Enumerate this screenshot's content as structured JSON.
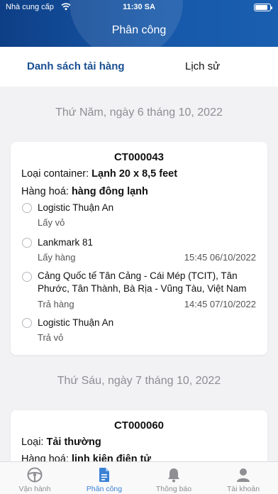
{
  "status": {
    "carrier": "Nhà cung cấp",
    "time": "11:30 SA",
    "battery_level": 0.85
  },
  "header": {
    "title": "Phân công"
  },
  "tabs": [
    {
      "label": "Danh sách tải hàng",
      "active": true
    },
    {
      "label": "Lịch sử",
      "active": false
    }
  ],
  "sections": [
    {
      "date": "Thứ Năm, ngày 6 tháng 10, 2022",
      "card": {
        "code": "CT000043",
        "container_label": "Loại container:",
        "container_value": "Lạnh 20 x 8,5 feet",
        "goods_label": "Hàng hoá:",
        "goods_value": "hàng đông lạnh",
        "stops": [
          {
            "name": "Logistic Thuận An",
            "action": "Lấy vỏ",
            "time": ""
          },
          {
            "name": "Lankmark 81",
            "action": "Lấy hàng",
            "time": "15:45 06/10/2022"
          },
          {
            "name": "Cảng Quốc tế Tân Cảng - Cái Mép (TCIT), Tân Phước, Tân Thành, Bà Rịa - Vũng Tàu, Việt Nam",
            "action": "Trả hàng",
            "time": "14:45 07/10/2022"
          },
          {
            "name": "Logistic Thuận An",
            "action": "Trả vỏ",
            "time": ""
          }
        ]
      }
    },
    {
      "date": "Thứ Sáu, ngày 7 tháng 10, 2022",
      "card": {
        "code": "CT000060",
        "container_label": "Loại:",
        "container_value": "Tải thường",
        "goods_label": "Hàng hoá:",
        "goods_value": "linh kiện điện tử"
      }
    }
  ],
  "bottom_nav": [
    {
      "label": "Vận hành",
      "icon": "steering-wheel-icon",
      "active": false
    },
    {
      "label": "Phân công",
      "icon": "document-icon",
      "active": true
    },
    {
      "label": "Thông báo",
      "icon": "bell-icon",
      "active": false
    },
    {
      "label": "Tài khoản",
      "icon": "user-icon",
      "active": false
    }
  ],
  "colors": {
    "header_start": "#0e3f86",
    "header_end": "#1a5fb0",
    "active_tab": "#1a4f92",
    "active_nav": "#3b82d6",
    "muted": "#8e8e93"
  }
}
